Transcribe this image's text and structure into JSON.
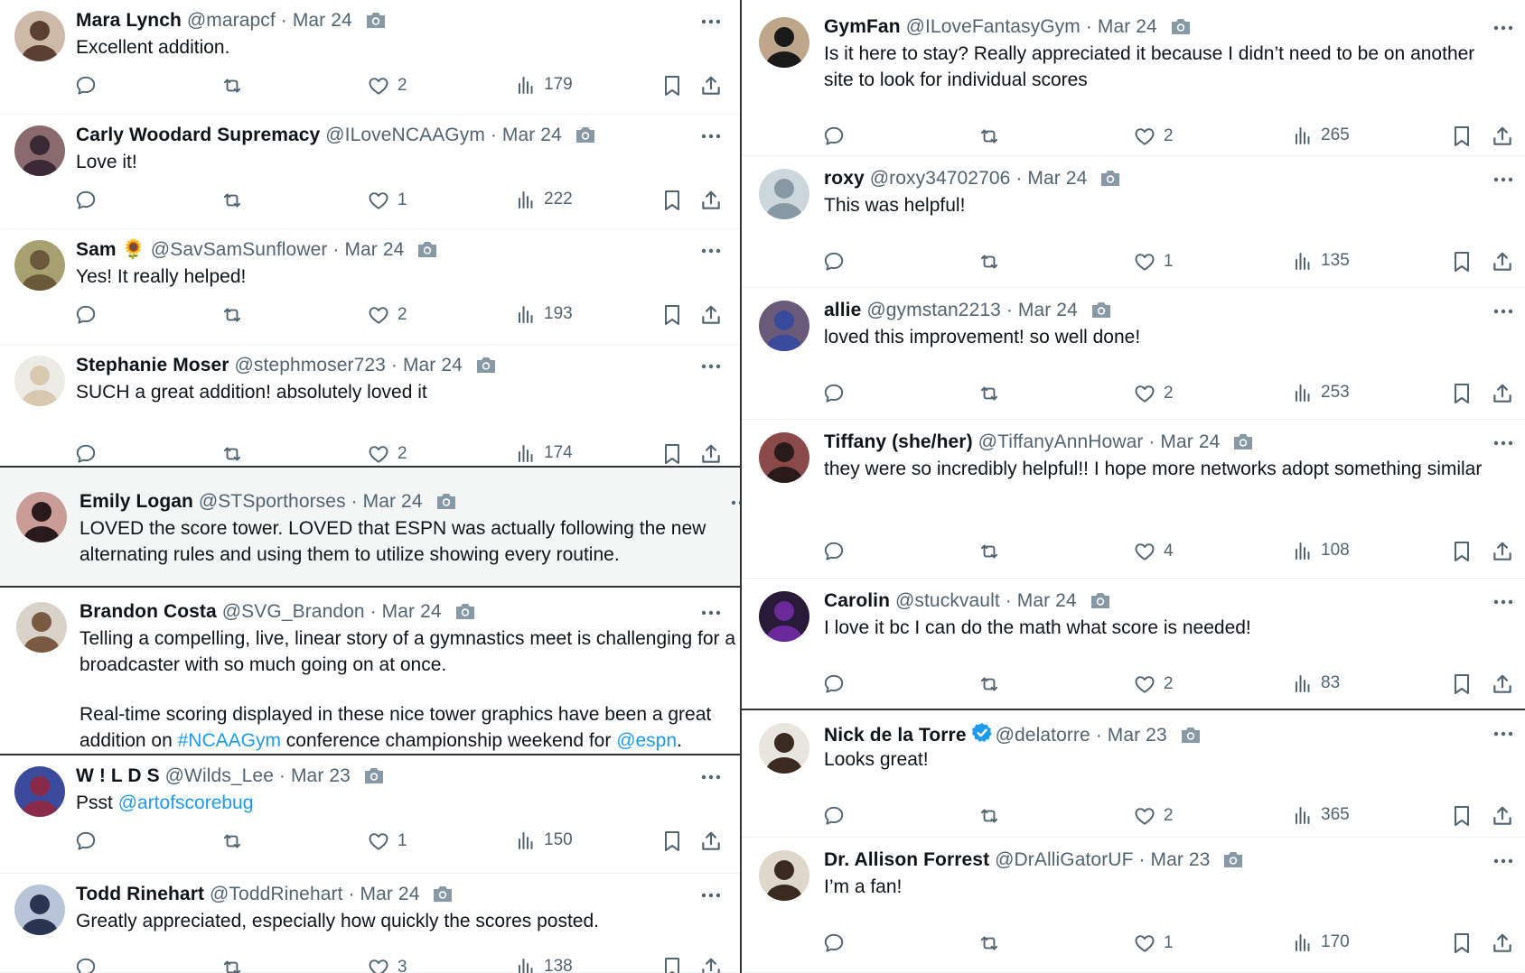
{
  "left": [
    {
      "name": "Mara Lynch",
      "handle": "@marapcf",
      "date": "Mar 24",
      "text": [
        "Excellent addition."
      ],
      "likes": "2",
      "views": "179",
      "avatar": "#5a4032",
      "avatar_bg": "#cdb9a8"
    },
    {
      "name": "Carly Woodard Supremacy",
      "handle": "@ILoveNCAAGym",
      "date": "Mar 24",
      "text": [
        "Love it!"
      ],
      "likes": "1",
      "views": "222",
      "avatar": "#3b2a35",
      "avatar_bg": "#8a6a6e"
    },
    {
      "name": "Sam",
      "emoji": "🌻",
      "handle": "@SavSamSunflower",
      "date": "Mar 24",
      "text": [
        "Yes! It really helped!"
      ],
      "likes": "2",
      "views": "193",
      "avatar": "#6a5a3a",
      "avatar_bg": "#a7a070"
    },
    {
      "name": "Stephanie Moser",
      "handle": "@stephmoser723",
      "date": "Mar 24",
      "text": [
        "SUCH a great addition! absolutely loved it"
      ],
      "likes": "2",
      "views": "174",
      "avatar": "#d8c8b0",
      "avatar_bg": "#ecebe6"
    },
    {
      "name": "Emily Logan",
      "handle": "@STSporthorses",
      "date": "Mar 24",
      "text": [
        "LOVED the score tower. LOVED that ESPN was actually following the new alternating rules and using them to utilize showing every routine."
      ],
      "avatar": "#2a1a1e",
      "avatar_bg": "#c99c95"
    },
    {
      "name": "Brandon Costa",
      "handle": "@SVG_Brandon",
      "date": "Mar 24",
      "text": [
        "Telling a compelling, live, linear story of a gymnastics meet is challenging for a broadcaster with so much going on at once."
      ],
      "text2_pre": "Real-time scoring displayed in these nice tower graphics have been a great addition on ",
      "hashtag": "#NCAAGym",
      "text2_mid": " conference championship weekend for ",
      "mention": "@espn",
      "text2_post": ".",
      "avatar": "#7a5a40",
      "avatar_bg": "#d9d2c8"
    },
    {
      "name": "W ! L D S",
      "handle": "@Wilds_Lee",
      "date": "Mar 23",
      "text_pre": "Psst ",
      "mention": "@artofscorebug",
      "likes": "1",
      "views": "150",
      "avatar": "#8a2a4a",
      "avatar_bg": "#3b4a9a"
    },
    {
      "name": "Todd Rinehart",
      "handle": "@ToddRinehart",
      "date": "Mar 24",
      "text": [
        "Greatly appreciated, especially how quickly the scores posted."
      ],
      "likes": "3",
      "views": "138",
      "avatar": "#2a3550",
      "avatar_bg": "#b8c4d8"
    }
  ],
  "right": [
    {
      "name": "GymFan",
      "handle": "@ILoveFantasyGym",
      "date": "Mar 24",
      "text": [
        "Is it here to stay? Really appreciated it because I didn’t need to be on another site to look for individual scores"
      ],
      "likes": "2",
      "views": "265",
      "avatar": "#1a1a1a",
      "avatar_bg": "#bda68a"
    },
    {
      "name": "roxy",
      "handle": "@roxy34702706",
      "date": "Mar 24",
      "text": [
        "This was helpful!"
      ],
      "likes": "1",
      "views": "135",
      "avatar": "#8899a6",
      "avatar_bg": "#ccd6dd"
    },
    {
      "name": "allie",
      "handle": "@gymstan2213",
      "date": "Mar 24",
      "text": [
        "loved this improvement! so well done!"
      ],
      "likes": "2",
      "views": "253",
      "avatar": "#3a4a9a",
      "avatar_bg": "#6a5a7a"
    },
    {
      "name": "Tiffany (she/her)",
      "handle": "@TiffanyAnnHowar",
      "date": "Mar 24",
      "text": [
        "they were so incredibly helpful!! I hope more networks adopt something similar"
      ],
      "likes": "4",
      "views": "108",
      "avatar": "#2a1a1a",
      "avatar_bg": "#8a4a4a"
    },
    {
      "name": "Carolin",
      "handle": "@stuckvault",
      "date": "Mar 24",
      "text": [
        "I love it bc I can do the math what score is needed!"
      ],
      "likes": "2",
      "views": "83",
      "avatar": "#6a2a9a",
      "avatar_bg": "#2a1a3a"
    },
    {
      "name": "Nick de la Torre",
      "verified": true,
      "handle": "@delatorre",
      "date": "Mar 23",
      "text": [
        "Looks great!"
      ],
      "likes": "2",
      "views": "365",
      "avatar": "#3a2a20",
      "avatar_bg": "#e8e4de"
    },
    {
      "name": "Dr. Allison Forrest",
      "handle": "@DrAlliGatorUF",
      "date": "Mar 23",
      "text": [
        "I’m a fan!"
      ],
      "likes": "1",
      "views": "170",
      "avatar": "#3a2a20",
      "avatar_bg": "#dfd6cc"
    }
  ],
  "colors": {
    "text": "#0f1419",
    "muted": "#536471",
    "link": "#1d9bf0",
    "divider": "#2f3336",
    "verified": "#1d9bf0",
    "highlight_bg": "#f4f5f5"
  },
  "icons": [
    "reply-icon",
    "retweet-icon",
    "heart-icon",
    "views-icon",
    "bookmark-icon",
    "share-icon",
    "more-icon",
    "camera-icon",
    "verified-icon"
  ]
}
